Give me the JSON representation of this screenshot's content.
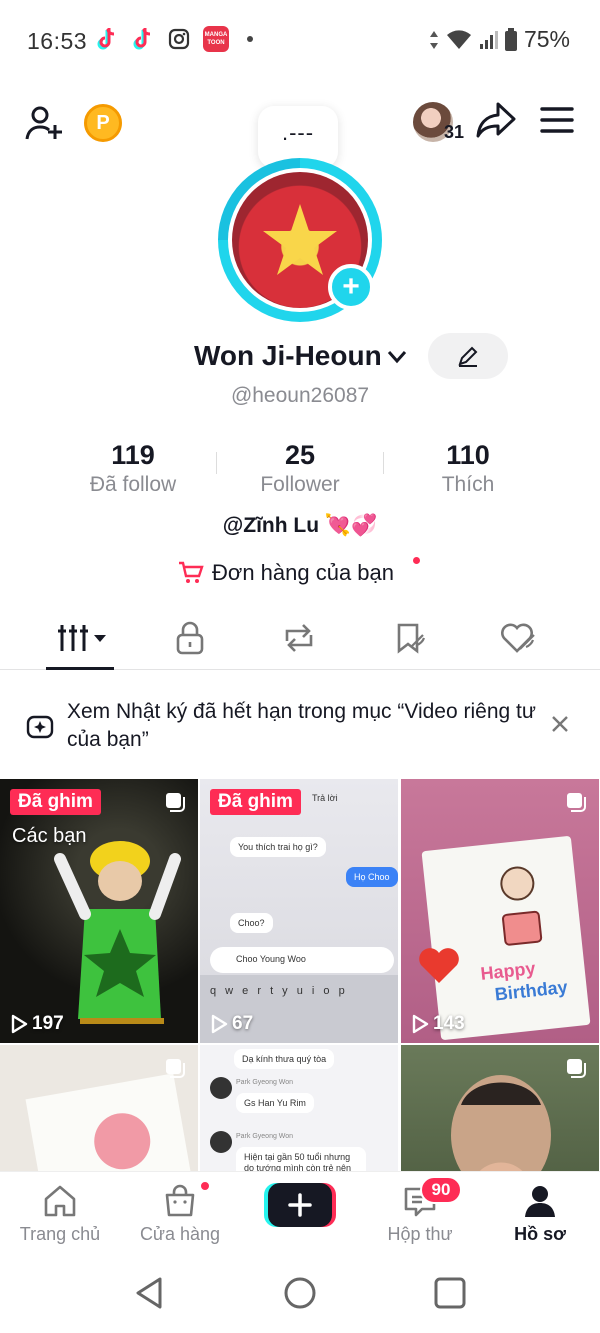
{
  "status_bar": {
    "time": "16:53",
    "battery": "75%",
    "icons": [
      "tiktok-icon",
      "tiktok-icon",
      "instagram-icon",
      "mangatoon-icon",
      "dot-icon",
      "data-arrows-icon",
      "wifi-icon",
      "signal-icon",
      "battery-icon"
    ],
    "manga_label": "MANGA TOON"
  },
  "header": {
    "friend_count": "31",
    "coin_label": "P"
  },
  "note": {
    "text": ".---"
  },
  "profile": {
    "name": "Won Ji-Heoun",
    "handle": "@heoun26087",
    "bio": "@Zĩnh Lu",
    "bio_emoji": "💘💞",
    "orders_label": "Đơn hàng của bạn"
  },
  "stats": [
    {
      "value": "119",
      "label": "Đã follow"
    },
    {
      "value": "25",
      "label": "Follower"
    },
    {
      "value": "110",
      "label": "Thích"
    }
  ],
  "tabs": [
    {
      "name": "videos",
      "icon": "grid-icon"
    },
    {
      "name": "private",
      "icon": "lock-icon"
    },
    {
      "name": "reposts",
      "icon": "repost-icon"
    },
    {
      "name": "favorites",
      "icon": "bookmark-icon"
    },
    {
      "name": "liked",
      "icon": "heart-icon"
    }
  ],
  "notice": {
    "text": "Xem Nhật ký đã hết hạn trong mục “Video riêng tư của bạn”"
  },
  "videos": [
    {
      "pinned": "Đã ghim",
      "views": "197",
      "caption": "Các bạn"
    },
    {
      "pinned": "Đã ghim",
      "views": "67",
      "caption": ""
    },
    {
      "pinned": "",
      "views": "143",
      "caption": ""
    },
    {
      "pinned": "",
      "views": "",
      "caption": ""
    },
    {
      "pinned": "",
      "views": "",
      "caption": ""
    },
    {
      "pinned": "",
      "views": "",
      "caption": ""
    }
  ],
  "chat_snippets": {
    "reply": "Trả lời",
    "q1": "You thích trai họ gì?",
    "a1": "Họ Choo",
    "q2": "Choo?",
    "input": "Choo Young Woo",
    "keys": "q w e r t y u i o p",
    "c1": "Dạ kính thưa quý tòa",
    "n1": "Park Gyeong Won",
    "c2": "Gs Han Yu Rim",
    "n2": "Park Gyeong Won",
    "c3": "Hiện tại gần 50 tuổi nhưng do tướng mình còn trẻ nên"
  },
  "cake_text": {
    "line1": "Happy",
    "line2": "Birthday"
  },
  "bottom_nav": [
    {
      "label": "Trang chủ",
      "icon": "home-icon"
    },
    {
      "label": "Cửa hàng",
      "icon": "shop-icon"
    },
    {
      "label": "",
      "icon": "create-icon"
    },
    {
      "label": "Hộp thư",
      "icon": "inbox-icon"
    },
    {
      "label": "Hồ sơ",
      "icon": "profile-icon"
    }
  ],
  "inbox_badge": "90",
  "colors": {
    "accent": "#fe2c55",
    "cyan": "#20d5ec",
    "text": "#161823",
    "muted": "#8a8b91"
  }
}
